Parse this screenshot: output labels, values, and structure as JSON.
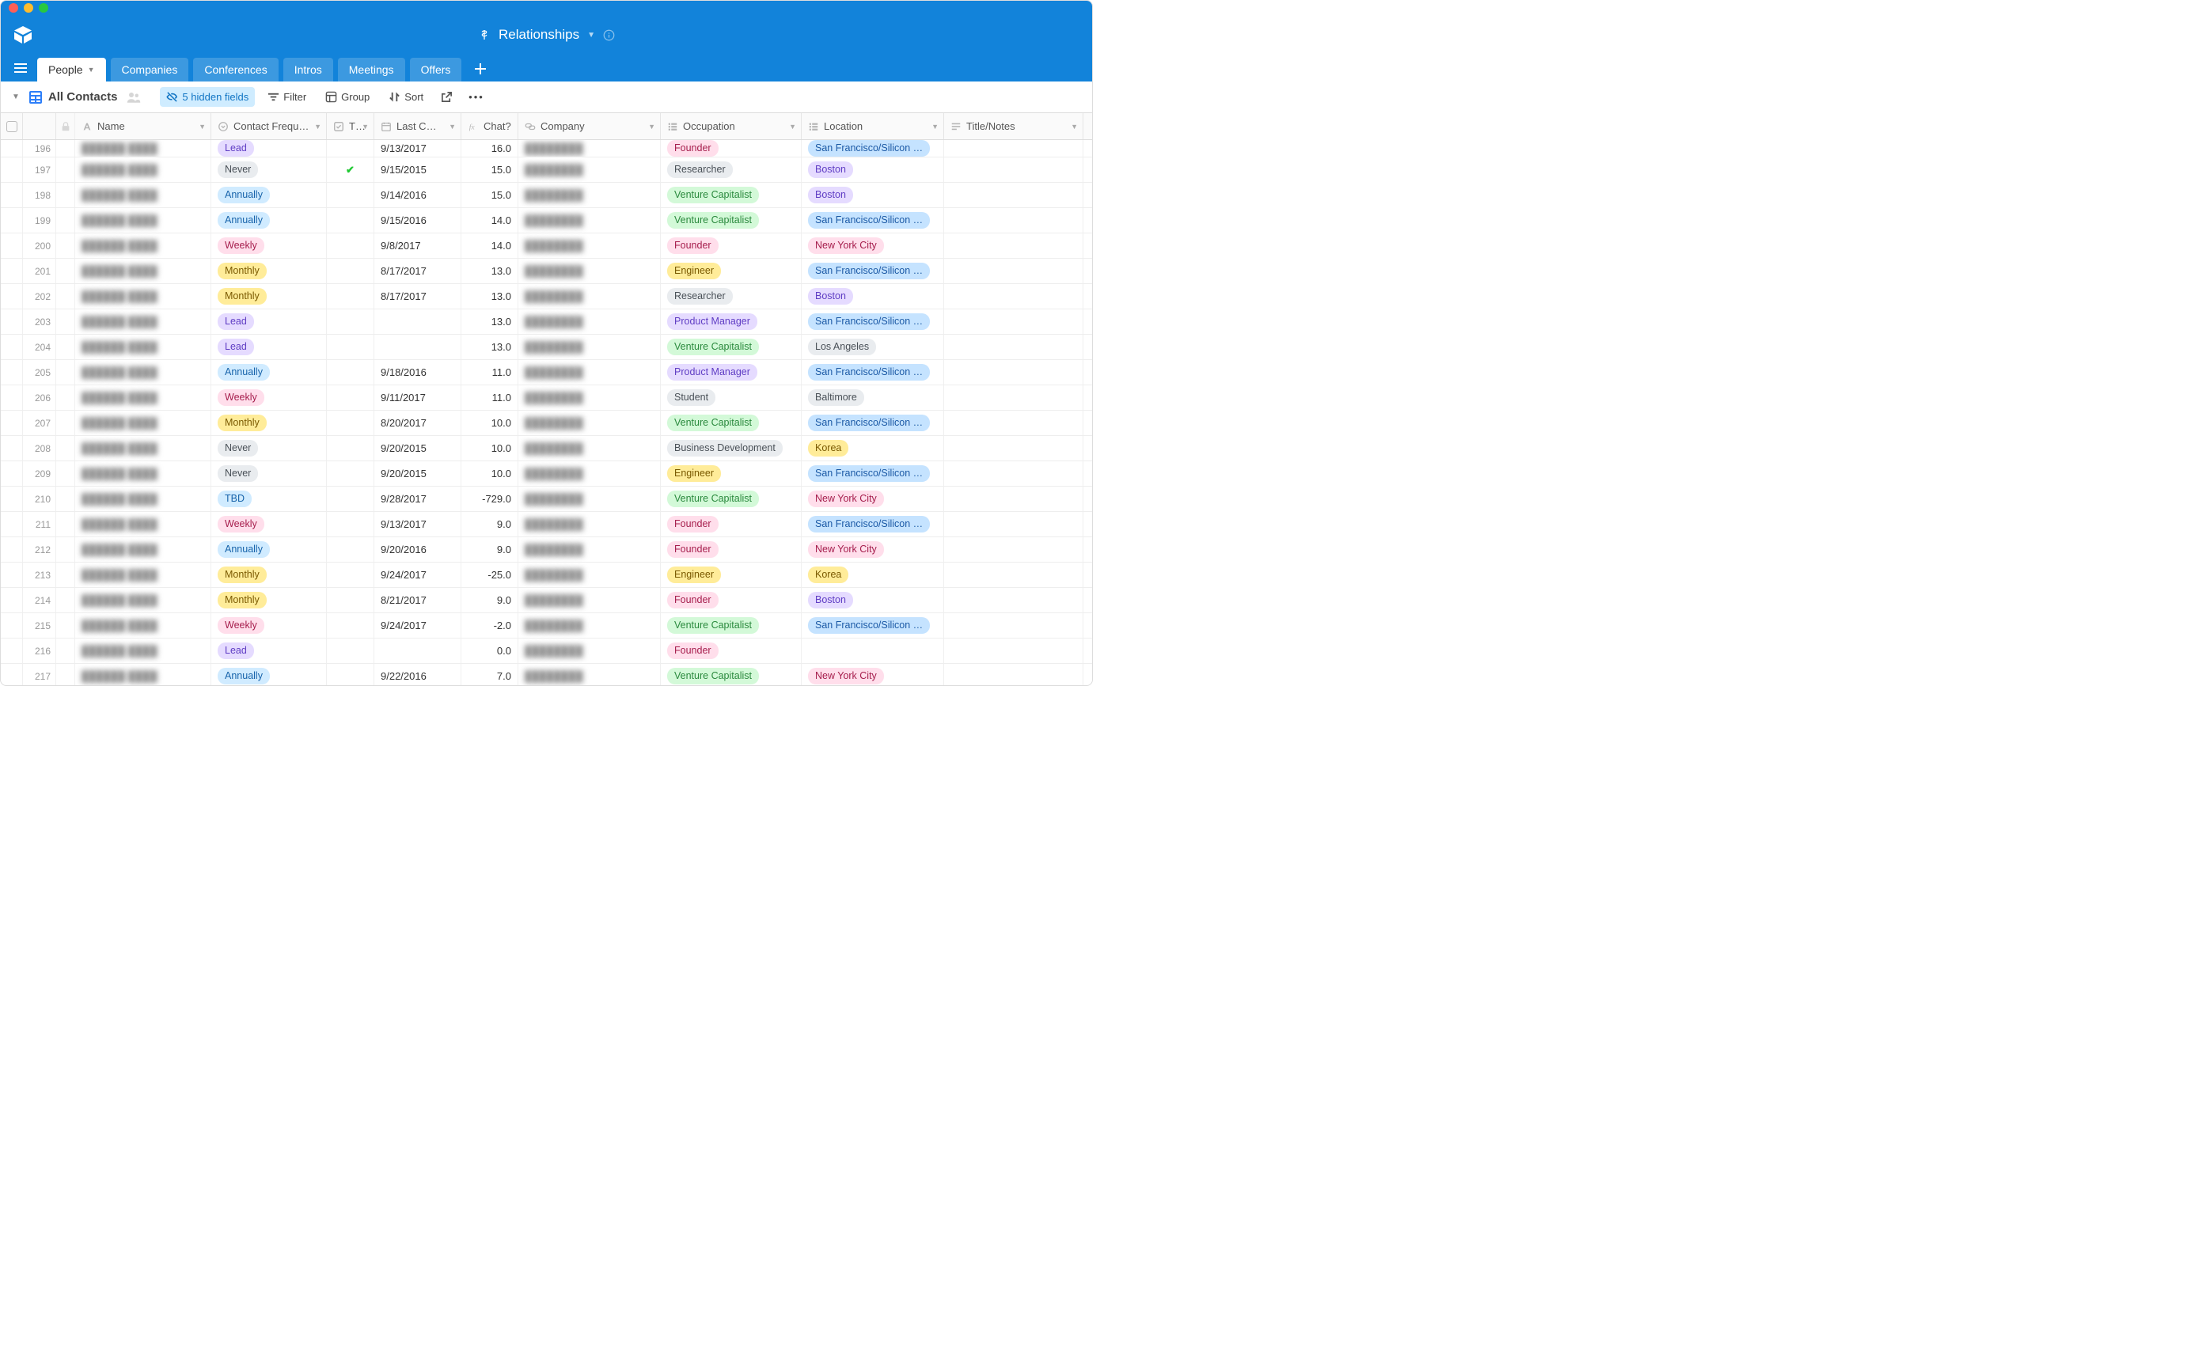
{
  "app_title": "Relationships",
  "tabs": [
    {
      "label": "People",
      "active": true,
      "has_caret": true
    },
    {
      "label": "Companies"
    },
    {
      "label": "Conferences"
    },
    {
      "label": "Intros"
    },
    {
      "label": "Meetings"
    },
    {
      "label": "Offers"
    }
  ],
  "view": {
    "name": "All Contacts",
    "hidden_fields_label": "5 hidden fields",
    "filter_label": "Filter",
    "group_label": "Group",
    "sort_label": "Sort"
  },
  "columns": {
    "name": "Name",
    "freq": "Contact Frequ…",
    "t": "T…",
    "last": "Last C…",
    "chat": "Chat?",
    "company": "Company",
    "occ": "Occupation",
    "loc": "Location",
    "title": "Title/Notes"
  },
  "pills": {
    "freq": {
      "Lead": "purple",
      "Never": "gray",
      "Annually": "blue",
      "Weekly": "pink",
      "Monthly": "yellow",
      "TBD": "blue"
    },
    "occ": {
      "Founder": "pink",
      "Researcher": "gray",
      "Venture Capitalist": "green",
      "Engineer": "yellow",
      "Product Manager": "purple",
      "Student": "gray",
      "Business Development": "gray"
    },
    "loc": {
      "San Francisco/Silicon …": "lightblue",
      "Boston": "purple",
      "New York City": "pink",
      "Los Angeles": "gray",
      "Baltimore": "gray",
      "Korea": "yellow"
    }
  },
  "rows": [
    {
      "num": 196,
      "freq": "Lead",
      "t": false,
      "last": "9/13/2017",
      "chat": "16.0",
      "occ": "Founder",
      "loc": "San Francisco/Silicon …"
    },
    {
      "num": 197,
      "freq": "Never",
      "t": true,
      "last": "9/15/2015",
      "chat": "15.0",
      "occ": "Researcher",
      "loc": "Boston"
    },
    {
      "num": 198,
      "freq": "Annually",
      "t": false,
      "last": "9/14/2016",
      "chat": "15.0",
      "occ": "Venture Capitalist",
      "loc": "Boston"
    },
    {
      "num": 199,
      "freq": "Annually",
      "t": false,
      "last": "9/15/2016",
      "chat": "14.0",
      "occ": "Venture Capitalist",
      "loc": "San Francisco/Silicon …"
    },
    {
      "num": 200,
      "freq": "Weekly",
      "t": false,
      "last": "9/8/2017",
      "chat": "14.0",
      "occ": "Founder",
      "loc": "New York City"
    },
    {
      "num": 201,
      "freq": "Monthly",
      "t": false,
      "last": "8/17/2017",
      "chat": "13.0",
      "occ": "Engineer",
      "loc": "San Francisco/Silicon …"
    },
    {
      "num": 202,
      "freq": "Monthly",
      "t": false,
      "last": "8/17/2017",
      "chat": "13.0",
      "occ": "Researcher",
      "loc": "Boston"
    },
    {
      "num": 203,
      "freq": "Lead",
      "t": false,
      "last": "",
      "chat": "13.0",
      "occ": "Product Manager",
      "loc": "San Francisco/Silicon …"
    },
    {
      "num": 204,
      "freq": "Lead",
      "t": false,
      "last": "",
      "chat": "13.0",
      "occ": "Venture Capitalist",
      "loc": "Los Angeles"
    },
    {
      "num": 205,
      "freq": "Annually",
      "t": false,
      "last": "9/18/2016",
      "chat": "11.0",
      "occ": "Product Manager",
      "loc": "San Francisco/Silicon …"
    },
    {
      "num": 206,
      "freq": "Weekly",
      "t": false,
      "last": "9/11/2017",
      "chat": "11.0",
      "occ": "Student",
      "loc": "Baltimore"
    },
    {
      "num": 207,
      "freq": "Monthly",
      "t": false,
      "last": "8/20/2017",
      "chat": "10.0",
      "occ": "Venture Capitalist",
      "loc": "San Francisco/Silicon …"
    },
    {
      "num": 208,
      "freq": "Never",
      "t": false,
      "last": "9/20/2015",
      "chat": "10.0",
      "occ": "Business Development",
      "loc": "Korea"
    },
    {
      "num": 209,
      "freq": "Never",
      "t": false,
      "last": "9/20/2015",
      "chat": "10.0",
      "occ": "Engineer",
      "loc": "San Francisco/Silicon …"
    },
    {
      "num": 210,
      "freq": "TBD",
      "t": false,
      "last": "9/28/2017",
      "chat": "-729.0",
      "occ": "Venture Capitalist",
      "loc": "New York City"
    },
    {
      "num": 211,
      "freq": "Weekly",
      "t": false,
      "last": "9/13/2017",
      "chat": "9.0",
      "occ": "Founder",
      "loc": "San Francisco/Silicon …"
    },
    {
      "num": 212,
      "freq": "Annually",
      "t": false,
      "last": "9/20/2016",
      "chat": "9.0",
      "occ": "Founder",
      "loc": "New York City"
    },
    {
      "num": 213,
      "freq": "Monthly",
      "t": false,
      "last": "9/24/2017",
      "chat": "-25.0",
      "occ": "Engineer",
      "loc": "Korea"
    },
    {
      "num": 214,
      "freq": "Monthly",
      "t": false,
      "last": "8/21/2017",
      "chat": "9.0",
      "occ": "Founder",
      "loc": "Boston"
    },
    {
      "num": 215,
      "freq": "Weekly",
      "t": false,
      "last": "9/24/2017",
      "chat": "-2.0",
      "occ": "Venture Capitalist",
      "loc": "San Francisco/Silicon …"
    },
    {
      "num": 216,
      "freq": "Lead",
      "t": false,
      "last": "",
      "chat": "0.0",
      "occ": "Founder",
      "loc": ""
    },
    {
      "num": 217,
      "freq": "Annually",
      "t": false,
      "last": "9/22/2016",
      "chat": "7.0",
      "occ": "Venture Capitalist",
      "loc": "New York City"
    }
  ]
}
